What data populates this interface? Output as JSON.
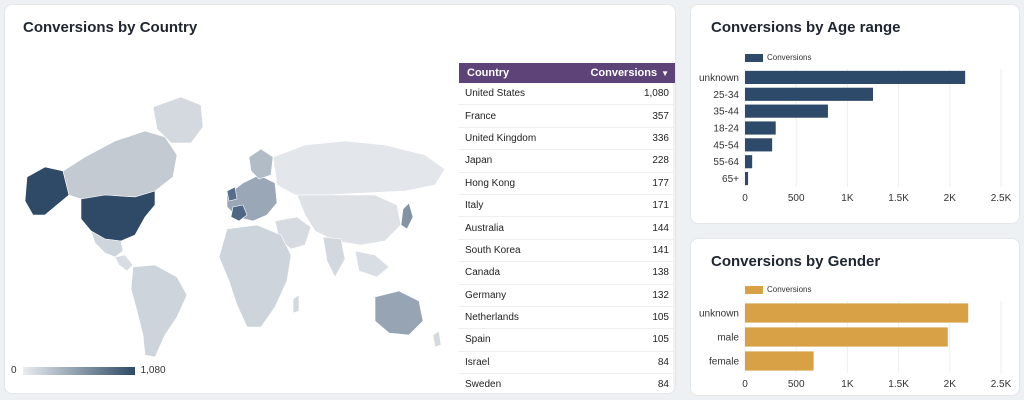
{
  "country_card": {
    "title": "Conversions by Country",
    "legend_min": "0",
    "legend_max": "1,080",
    "table": {
      "col_country": "Country",
      "col_conversions": "Conversions",
      "rows": [
        {
          "country": "United States",
          "value": "1,080"
        },
        {
          "country": "France",
          "value": "357"
        },
        {
          "country": "United Kingdom",
          "value": "336"
        },
        {
          "country": "Japan",
          "value": "228"
        },
        {
          "country": "Hong Kong",
          "value": "177"
        },
        {
          "country": "Italy",
          "value": "171"
        },
        {
          "country": "Australia",
          "value": "144"
        },
        {
          "country": "South Korea",
          "value": "141"
        },
        {
          "country": "Canada",
          "value": "138"
        },
        {
          "country": "Germany",
          "value": "132"
        },
        {
          "country": "Netherlands",
          "value": "105"
        },
        {
          "country": "Spain",
          "value": "105"
        },
        {
          "country": "Israel",
          "value": "84"
        },
        {
          "country": "Sweden",
          "value": "84"
        }
      ]
    }
  },
  "age_card": {
    "title": "Conversions by Age range"
  },
  "gender_card": {
    "title": "Conversions by Gender"
  },
  "colors": {
    "age_bar": "#2d4a6b",
    "gender_bar": "#d9a145",
    "table_header": "#5d4378",
    "map_max": "#2e4a66",
    "map_min": "#e9ecf0"
  },
  "chart_data": [
    {
      "type": "bar",
      "orientation": "horizontal",
      "title": "Conversions by Age range",
      "categories": [
        "unknown",
        "25-34",
        "35-44",
        "18-24",
        "45-54",
        "55-64",
        "65+"
      ],
      "series": [
        {
          "name": "Conversions",
          "values": [
            2150,
            1250,
            810,
            300,
            265,
            70,
            30
          ]
        }
      ],
      "xlim": [
        0,
        2500
      ],
      "xticks": [
        "0",
        "500",
        "1K",
        "1.5K",
        "2K",
        "2.5K"
      ],
      "legend": "top-left",
      "grid": true
    },
    {
      "type": "bar",
      "orientation": "horizontal",
      "title": "Conversions by Gender",
      "categories": [
        "unknown",
        "male",
        "female"
      ],
      "series": [
        {
          "name": "Conversions",
          "values": [
            2180,
            1980,
            670
          ]
        }
      ],
      "xlim": [
        0,
        2500
      ],
      "xticks": [
        "0",
        "500",
        "1K",
        "1.5K",
        "2K",
        "2.5K"
      ],
      "legend": "top-left",
      "grid": true
    }
  ]
}
